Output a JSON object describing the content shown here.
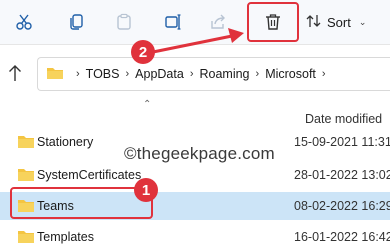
{
  "toolbar": {
    "sort_label": "Sort",
    "icons": [
      "scissors-icon",
      "copy-icon",
      "paste-icon",
      "rename-icon",
      "share-icon",
      "delete-icon",
      "sort-icon"
    ]
  },
  "address": {
    "crumbs": [
      "TOBS",
      "AppData",
      "Roaming",
      "Microsoft"
    ]
  },
  "columns": {
    "date_modified": "Date modified"
  },
  "watermark": "©thegeekpage.com",
  "rows": [
    {
      "name": "Stationery",
      "date": "15-09-2021 11:31"
    },
    {
      "name": "SystemCertificates",
      "date": "28-01-2022 13:02"
    },
    {
      "name": "Teams",
      "date": "08-02-2022 16:29"
    },
    {
      "name": "Templates",
      "date": "16-01-2022 16:42"
    }
  ],
  "annotations": {
    "step1": "1",
    "step2": "2"
  },
  "colors": {
    "accent_red": "#e0323c",
    "selection": "#cce4f7",
    "folder": "#f4c542"
  }
}
